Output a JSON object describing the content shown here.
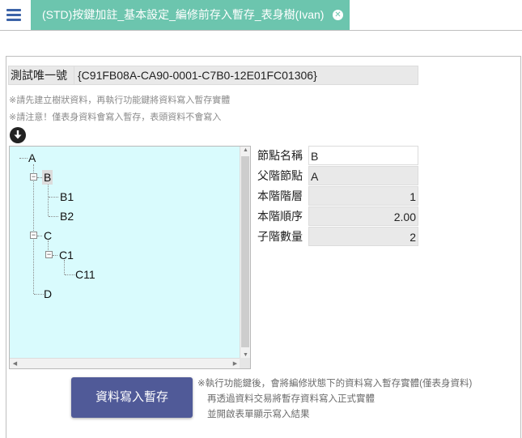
{
  "header": {
    "menu_icon": "hamburger-icon",
    "tab_title": "(STD)按鍵加註_基本設定_編修前存入暫存_表身樹(Ivan)",
    "tab_close_icon": "close-circle-icon",
    "tab_color": "#6cc5ae"
  },
  "form": {
    "id_label": "測試唯一號",
    "id_value": "{C91FB08A-CA90-0001-C7B0-12E01FC01306}",
    "notes": [
      "※請先建立樹狀資料，再執行功能鍵將資料寫入暫存實體",
      "※請注意！僅表身資料會寫入暫存，表頭資料不會寫入"
    ],
    "download_icon": "download-circle-icon"
  },
  "tree": {
    "background": "#d9fbfd",
    "nodes": [
      {
        "label": "A"
      },
      {
        "label": "B",
        "selected": true
      },
      {
        "label": "B1"
      },
      {
        "label": "B2"
      },
      {
        "label": "C"
      },
      {
        "label": "C1"
      },
      {
        "label": "C11"
      },
      {
        "label": "D"
      }
    ]
  },
  "properties": [
    {
      "label": "節點名稱",
      "value": "B"
    },
    {
      "label": "父階節點",
      "value": "A"
    },
    {
      "label": "本階階層",
      "value": "1"
    },
    {
      "label": "本階順序",
      "value": "2.00"
    },
    {
      "label": "子階數量",
      "value": "2"
    }
  ],
  "footer": {
    "save_button": "資料寫入暫存",
    "button_color": "#505a98",
    "notes": [
      "※執行功能鍵後，會將編修狀態下的資料寫入暫存實體(僅表身資料)",
      "再透過資料交易將暫存資料寫入正式實體",
      "並開啟表單顯示寫入結果"
    ]
  }
}
